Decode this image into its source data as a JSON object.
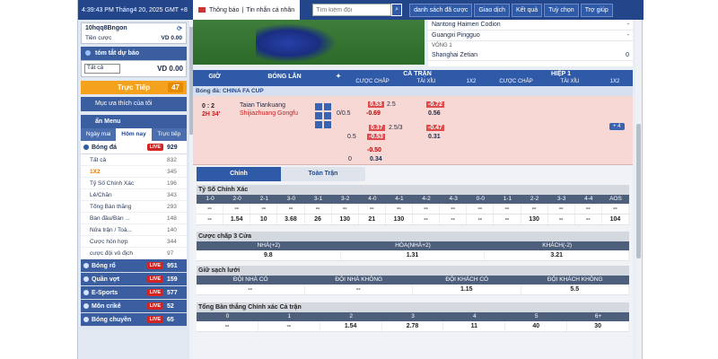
{
  "topbar": {
    "datetime": "4:39:43 PM Tháng4 20, 2025 GMT +8",
    "notice_label": "Thông báo",
    "notice_sep": "|",
    "personal_msg": "Tin nhắn cá nhân",
    "search_placeholder": "Tìm kiếm đội",
    "buttons": [
      "danh sách đã cược",
      "Giao dịch",
      "Kết quả",
      "Tuỳ chọn",
      "Trợ giúp"
    ]
  },
  "account": {
    "username": "10hqq8Bngon",
    "currency_label": "Tiền cược",
    "balance": "VD 0.00"
  },
  "bet_slip": {
    "title": "tóm tắt dự báo",
    "select_value": "Tất cả",
    "amount": "VD 0.00"
  },
  "live_bar": {
    "label": "Trực Tiếp",
    "count": "47"
  },
  "favourites": "Mục ưa thích của tôi",
  "menu": {
    "title": "ẩn Menu",
    "tabs": [
      "Ngày mai",
      "Hôm nay",
      "Trực tiếp"
    ],
    "football": {
      "label": "Bóng đá",
      "count": "929",
      "live": "LIVE"
    },
    "sub_items": [
      {
        "label": "Tất cả",
        "count": "832"
      },
      {
        "label": "1X2",
        "count": "345"
      },
      {
        "label": "Tỷ Số Chính Xác",
        "count": "196"
      },
      {
        "label": "Lẻ/Chẵn",
        "count": "343"
      },
      {
        "label": "Tổng Bàn thắng",
        "count": "293"
      },
      {
        "label": "Bàn đầu/Bàn ...",
        "count": "148"
      },
      {
        "label": "Nửa trận / Toà...",
        "count": "140"
      },
      {
        "label": "Cược hỗn hợp",
        "count": "344"
      },
      {
        "label": "cược đội vô địch",
        "count": "97"
      }
    ],
    "sports": [
      {
        "label": "Bóng rổ",
        "count": "951",
        "live": "LIVE"
      },
      {
        "label": "Quần vợt",
        "count": "159",
        "live": "LIVE"
      },
      {
        "label": "E-Sports",
        "count": "577",
        "live": "LIVE"
      },
      {
        "label": "Môn crikê",
        "count": "52",
        "live": "LIVE"
      },
      {
        "label": "Bóng chuyền",
        "count": "65",
        "live": "LIVE"
      }
    ]
  },
  "results": {
    "rows": [
      {
        "team": "Nantong Haimen Codion",
        "score": "-"
      },
      {
        "team": "Guangxi Pingguo",
        "score": "-"
      }
    ],
    "round": "VÒNG 1",
    "row3": {
      "team": "Shanghai Zetian",
      "score": "0"
    }
  },
  "grid": {
    "col_time": "GIỜ",
    "col_match": "BÓNG LĂN",
    "fulltime": "CẢ TRẬN",
    "half": "HIỆP 1",
    "sub_cols": [
      "CƯỢC CHẤP",
      "TÀI XỈU",
      "1X2",
      "CƯỢC CHẤP",
      "TÀI XỈU",
      "1X2"
    ]
  },
  "league": "Bóng đá: CHINA FA CUP",
  "match": {
    "score": "0 : 2",
    "minute": "2H 34'",
    "home": "Taian Tiankuang",
    "away": "Shijiazhuang Gongfu",
    "hcap1": "0/0.5",
    "o1a": "0.53",
    "o1b": "-0.69",
    "ou1": "2.5",
    "u1a": "-0.72",
    "u1b": "0.56",
    "hcap2": "0.5",
    "o2a": "0.37",
    "o2b": "-0.53",
    "ou2": "2.5/3",
    "u2a": "-0.47",
    "u2b": "0.31",
    "hcap3": "0",
    "o3a": "-0.50",
    "o3b": "0.34",
    "more": "+ 4"
  },
  "detail": {
    "tabs": [
      "Chính",
      "Toàn Trận"
    ],
    "correct_score": {
      "title": "Tỷ Số Chính Xác",
      "headers": [
        "1-0",
        "2-0",
        "2-1",
        "3-0",
        "3-1",
        "3-2",
        "4-0",
        "4-1",
        "4-2",
        "4-3",
        "0-0",
        "1-1",
        "2-2",
        "3-3",
        "4-4",
        "AOS"
      ],
      "row1": [
        "--",
        "--",
        "--",
        "--",
        "--",
        "--",
        "--",
        "--",
        "--",
        "--",
        "--",
        "--",
        "--",
        "--",
        "--",
        "--"
      ],
      "row2": [
        "--",
        "1.54",
        "10",
        "3.68",
        "26",
        "130",
        "21",
        "130",
        "--",
        "--",
        "--",
        "--",
        "130",
        "--",
        "--",
        "104"
      ]
    },
    "hcap3way": {
      "title": "Cược chấp 3 Cửa",
      "headers": [
        "NHÀ(+2)",
        "HÒA(NHÀ+2)",
        "KHÁCH(-2)"
      ],
      "values": [
        "9.8",
        "1.31",
        "3.21"
      ]
    },
    "clean_sheet": {
      "title": "Giữ sạch lưới",
      "headers": [
        "ĐỘI NHÀ CÓ",
        "ĐỘI NHÀ KHÔNG",
        "ĐỘI KHÁCH CÓ",
        "ĐỘI KHÁCH KHÔNG"
      ],
      "values": [
        "--",
        "--",
        "1.15",
        "5.5"
      ]
    },
    "total_goals": {
      "title": "Tổng Bàn thắng Chính xác Cả trận",
      "headers": [
        "0",
        "1",
        "2",
        "3",
        "4",
        "5",
        "6+"
      ],
      "values": [
        "--",
        "--",
        "1.54",
        "2.78",
        "11",
        "40",
        "30"
      ]
    }
  }
}
